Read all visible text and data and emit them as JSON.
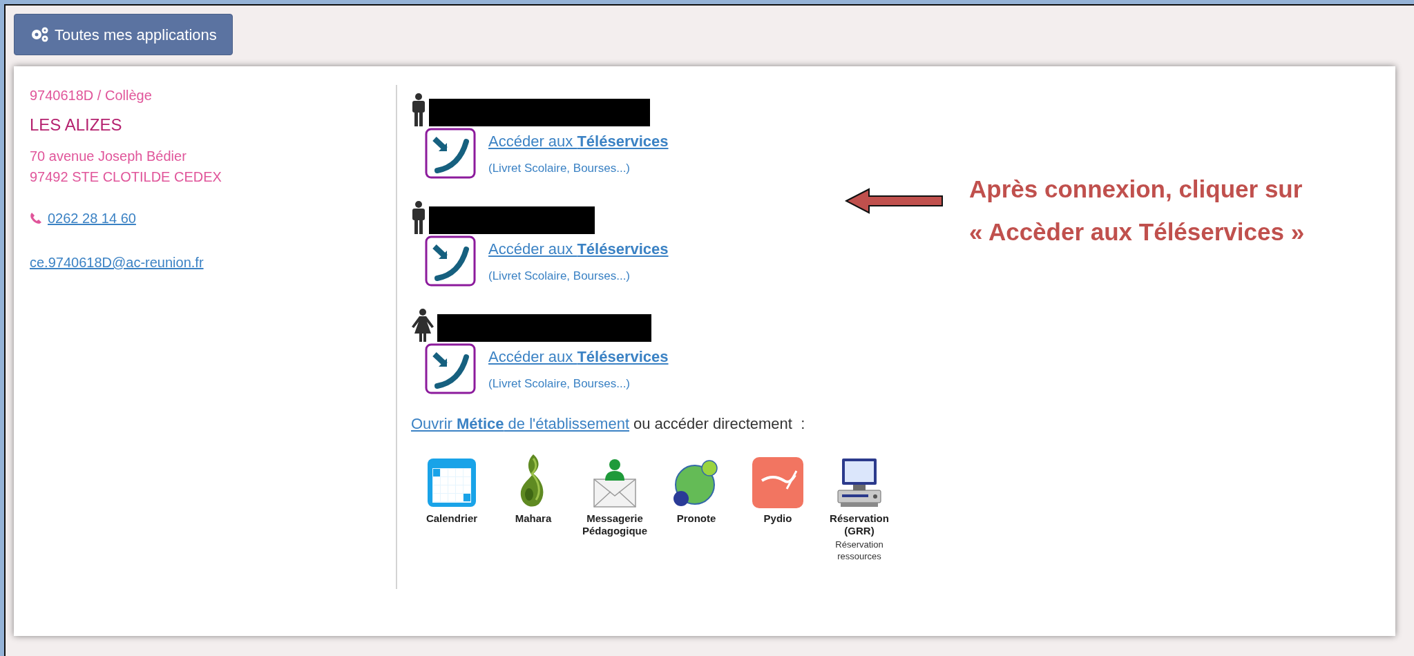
{
  "toolbar": {
    "button": "Toutes mes applications"
  },
  "school": {
    "code_type": "9740618D / Collège",
    "name": "LES ALIZES",
    "address": [
      "70 avenue Joseph Bédier",
      "97492 STE CLOTILDE CEDEX"
    ],
    "phone": "0262 28 14 60",
    "email": "ce.9740618D@ac-reunion.fr"
  },
  "children": [
    {
      "kind": "male",
      "link": "Accéder aux **Téléservices**",
      "note": "(Livret Scolaire, Bourses...)"
    },
    {
      "kind": "male",
      "link": "Accéder aux **Téléservices**",
      "note": "(Livret Scolaire, Bourses...)"
    },
    {
      "kind": "female",
      "link": "Accéder aux **Téléservices**",
      "note": "(Livret Scolaire, Bourses...)"
    }
  ],
  "metice": {
    "link": "Ouvrir **Métice** de l'établissement",
    "text": "ou accéder directement  :"
  },
  "apps": [
    {
      "kind": "calendar",
      "label": "Calendrier"
    },
    {
      "kind": "mahara",
      "label": "Mahara"
    },
    {
      "kind": "mail",
      "label": "Messagerie Pédagogique"
    },
    {
      "kind": "pronote",
      "label": "Pronote"
    },
    {
      "kind": "pydio",
      "label": "Pydio"
    },
    {
      "kind": "reservation",
      "label": "Réservation (GRR)",
      "note": "Réservation ressources"
    }
  ],
  "annotation": {
    "lines": [
      "Après connexion, cliquer sur",
      "« Accèder aux Téléservices »"
    ]
  }
}
